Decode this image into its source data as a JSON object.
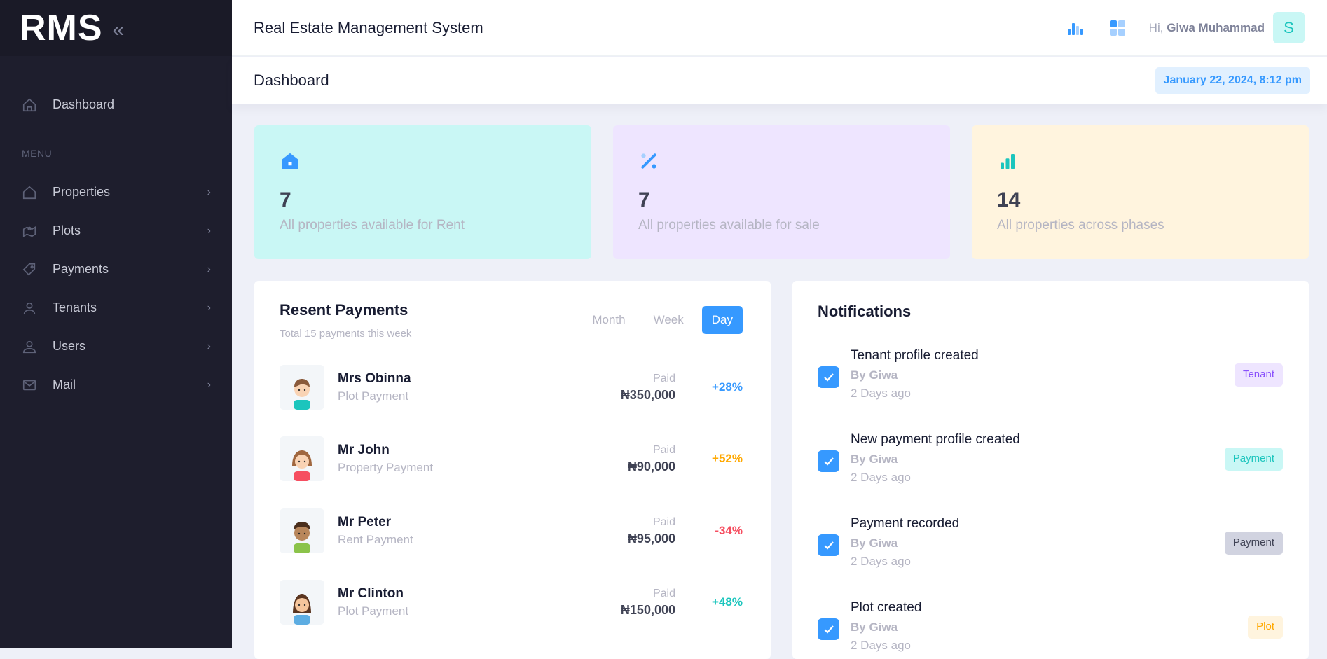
{
  "brand": {
    "name": "RMS",
    "collapse_icon": "double-chevron-left-icon"
  },
  "sidebar": {
    "dashboard": {
      "label": "Dashboard",
      "icon": "home-icon"
    },
    "menu_heading": "MENU",
    "items": [
      {
        "label": "Properties",
        "icon": "home-icon"
      },
      {
        "label": "Plots",
        "icon": "map-icon"
      },
      {
        "label": "Payments",
        "icon": "tag-icon"
      },
      {
        "label": "Tenants",
        "icon": "user-icon"
      },
      {
        "label": "Users",
        "icon": "users-icon"
      },
      {
        "label": "Mail",
        "icon": "mail-icon"
      }
    ]
  },
  "header": {
    "title": "Real Estate Management System",
    "greeting_prefix": "Hi,",
    "user_name": "Giwa Muhammad",
    "avatar_letter": "S"
  },
  "subheader": {
    "page_title": "Dashboard",
    "datetime": "January 22, 2024, 8:12 pm"
  },
  "stats": [
    {
      "value": "7",
      "label": "All properties available for Rent",
      "bg": "#c9f7f5",
      "icon": "home-icon",
      "accent": "#3699ff"
    },
    {
      "value": "7",
      "label": "All properties available for sale",
      "bg": "#eee5ff",
      "icon": "percent-icon",
      "accent": "#3699ff"
    },
    {
      "value": "14",
      "label": "All properties across phases",
      "bg": "#fff4de",
      "icon": "bar-chart-icon",
      "accent": "#1bc5bd"
    }
  ],
  "payments": {
    "title": "Resent Payments",
    "subtitle": "Total 15 payments this week",
    "tabs": [
      "Month",
      "Week",
      "Day"
    ],
    "active_tab": "Day",
    "rows": [
      {
        "name": "Mrs Obinna",
        "type": "Plot Payment",
        "status": "Paid",
        "amount": "₦350,000",
        "change": "+28%",
        "change_color": "#3699ff"
      },
      {
        "name": "Mr John",
        "type": "Property Payment",
        "status": "Paid",
        "amount": "₦90,000",
        "change": "+52%",
        "change_color": "#ffa800"
      },
      {
        "name": "Mr Peter",
        "type": "Rent Payment",
        "status": "Paid",
        "amount": "₦95,000",
        "change": "-34%",
        "change_color": "#f64e60"
      },
      {
        "name": "Mr Clinton",
        "type": "Plot Payment",
        "status": "Paid",
        "amount": "₦150,000",
        "change": "+48%",
        "change_color": "#1bc5bd"
      }
    ]
  },
  "notifications": {
    "title": "Notifications",
    "items": [
      {
        "title": "Tenant profile created",
        "by": "By Giwa",
        "time": "2 Days ago",
        "badge": "Tenant",
        "badge_bg": "#eee5ff",
        "badge_color": "#8950fc"
      },
      {
        "title": "New payment profile created",
        "by": "By Giwa",
        "time": "2 Days ago",
        "badge": "Payment",
        "badge_bg": "#c9f7f5",
        "badge_color": "#1bc5bd"
      },
      {
        "title": "Payment recorded",
        "by": "By Giwa",
        "time": "2 Days ago",
        "badge": "Payment",
        "badge_bg": "#d1d3e0",
        "badge_color": "#3f4254"
      },
      {
        "title": "Plot created",
        "by": "By Giwa",
        "time": "2 Days ago",
        "badge": "Plot",
        "badge_bg": "#fff4de",
        "badge_color": "#ffa800"
      }
    ]
  }
}
